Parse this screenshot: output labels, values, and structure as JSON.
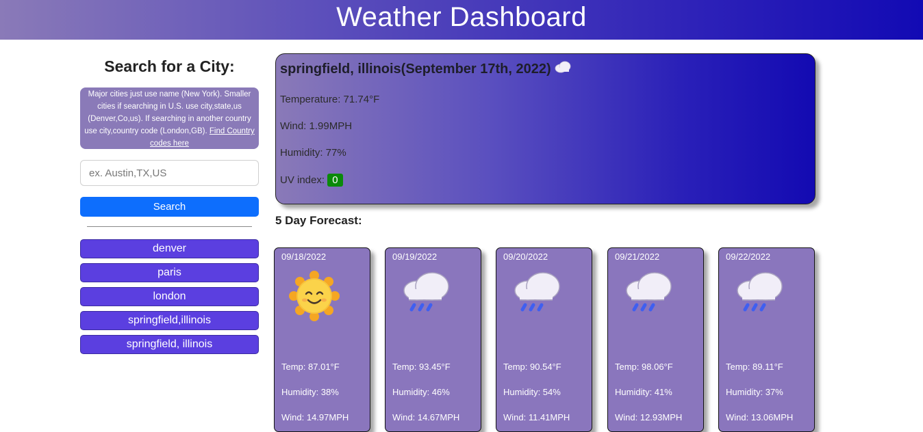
{
  "header": {
    "title": "Weather Dashboard"
  },
  "sidebar": {
    "search_title": "Search for a City:",
    "info_text": "Major cities just use name (New York). Smaller cities if searching in U.S. use city,state,us (Denver,Co,us). If searching in another country use city,country code (London,GB).",
    "info_link": "Find Country codes here",
    "search_placeholder": "ex. Austin,TX,US",
    "search_button": "Search",
    "history": [
      {
        "label": "denver"
      },
      {
        "label": "paris"
      },
      {
        "label": "london"
      },
      {
        "label": "springfield,illinois"
      },
      {
        "label": "springfield, illinois"
      }
    ]
  },
  "current": {
    "title": "springfield, illinois(September 17th, 2022)",
    "icon": "cloud-icon",
    "temperature": "Temperature: 71.74°F",
    "wind": "Wind: 1.99MPH",
    "humidity": "Humidity: 77%",
    "uv_label": "UV index:",
    "uv_value": "0",
    "uv_color": "#0a8a0a"
  },
  "forecast": {
    "title": "5 Day Forecast:",
    "days": [
      {
        "date": "09/18/2022",
        "icon": "sun-icon",
        "temp": "Temp: 87.01°F",
        "humidity": "Humidity: 38%",
        "wind": "Wind: 14.97MPH"
      },
      {
        "date": "09/19/2022",
        "icon": "rain-cloud-icon",
        "temp": "Temp: 93.45°F",
        "humidity": "Humidity: 46%",
        "wind": "Wind: 14.67MPH"
      },
      {
        "date": "09/20/2022",
        "icon": "rain-cloud-icon",
        "temp": "Temp: 90.54°F",
        "humidity": "Humidity: 54%",
        "wind": "Wind: 11.41MPH"
      },
      {
        "date": "09/21/2022",
        "icon": "rain-cloud-icon",
        "temp": "Temp: 98.06°F",
        "humidity": "Humidity: 41%",
        "wind": "Wind: 12.93MPH"
      },
      {
        "date": "09/22/2022",
        "icon": "rain-cloud-icon",
        "temp": "Temp: 89.11°F",
        "humidity": "Humidity: 37%",
        "wind": "Wind: 13.06MPH"
      }
    ]
  }
}
